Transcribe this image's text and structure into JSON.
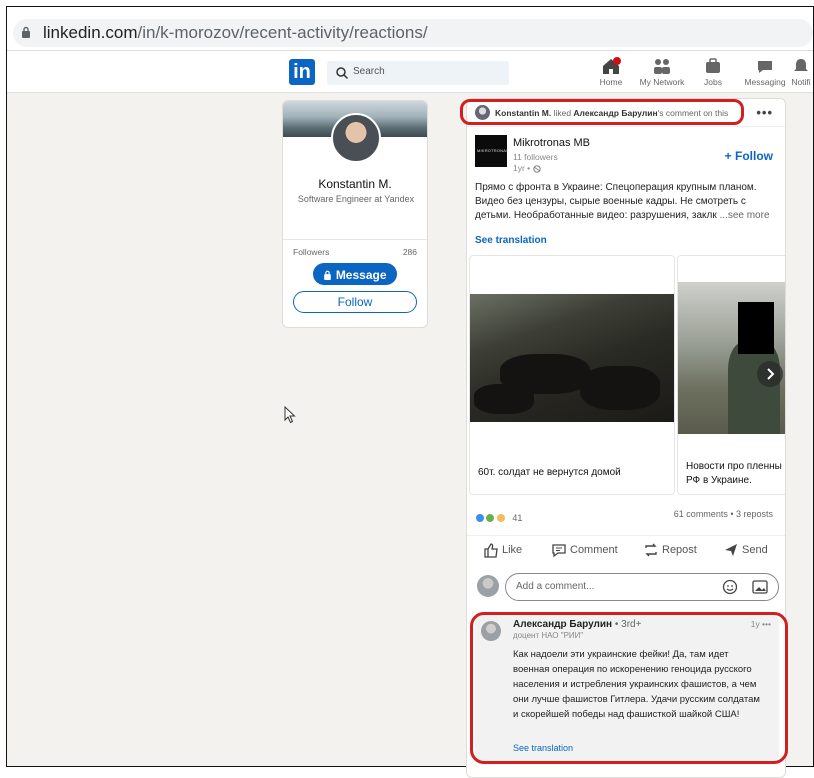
{
  "browser": {
    "url_host": "linkedin.com",
    "url_path": "/in/k-morozov/recent-activity/reactions/"
  },
  "nav": {
    "logo": "in",
    "search_placeholder": "Search",
    "items": [
      {
        "label": "Home",
        "icon": "home-icon"
      },
      {
        "label": "My Network",
        "icon": "network-icon"
      },
      {
        "label": "Jobs",
        "icon": "jobs-icon"
      },
      {
        "label": "Messaging",
        "icon": "messaging-icon"
      },
      {
        "label": "Notifi",
        "icon": "notifications-icon"
      }
    ]
  },
  "profile": {
    "name": "Konstantin M.",
    "title": "Software Engineer at Yandex",
    "followers_label": "Followers",
    "followers_count": "286",
    "message_label": "Message",
    "follow_label": "Follow"
  },
  "post": {
    "actor": "Konstantin M.",
    "actor_suffix": " liked ",
    "target": "Александр Барулин",
    "target_suffix": "'s comment on this",
    "more": "•••",
    "company": {
      "logo_text": "MIKROTRONAS",
      "name": "Mikrotronas MB",
      "followers": "11 followers",
      "time": "1yr •",
      "follow_label": "+ Follow"
    },
    "text": "Прямо с фронта в Украине: Спецоперация крупным планом. Видео без цензуры, сырые военные кадры. Не смотреть с детьми. Необработанные видео: разрушения, заклк ",
    "see_more": "...see more",
    "see_translation": "See translation",
    "carousel": [
      {
        "caption": "60т. солдат не вернутся домой"
      },
      {
        "caption": "Новости про пленны РФ в Украине."
      }
    ],
    "reactions_count": "41",
    "counts_text": "61 comments • 3 reposts",
    "actions": [
      {
        "label": "Like",
        "icon": "like-icon"
      },
      {
        "label": "Comment",
        "icon": "comment-icon"
      },
      {
        "label": "Repost",
        "icon": "repost-icon"
      },
      {
        "label": "Send",
        "icon": "send-icon"
      }
    ],
    "comment_placeholder": "Add a comment...",
    "comment": {
      "author": "Александр Барулин",
      "degree": " • 3rd+",
      "time": "1y •••",
      "subtitle": "доцент НАО \"РИИ\"",
      "text": "Как надоели эти украинские фейки! Да, там идет военная операция по искоренению геноцида русского населения и истребления украинских фашистов, а чем они лучше фашистов Гитлера. Удачи русским солдатам и скорейшей победы над фашисткой шайкой США!",
      "see_translation": "See translation"
    }
  },
  "colors": {
    "brand": "#0a66c2",
    "highlight": "#d21f1f",
    "page_bg": "#f3f2ef"
  }
}
